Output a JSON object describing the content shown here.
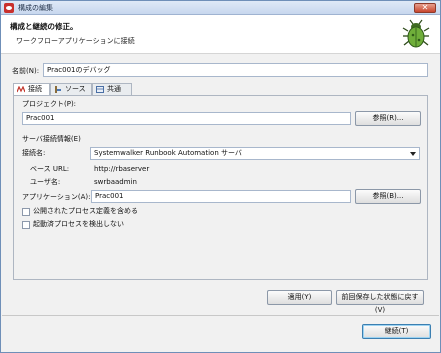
{
  "window": {
    "title": "構成の編集",
    "close_icon": "close-icon"
  },
  "header": {
    "title": "構成と継続の修正。",
    "subtitle": "ワークフローアプリケーションに接続",
    "icon": "bug-icon"
  },
  "name": {
    "label": "名前(N):",
    "value": "Prac001のデバッグ"
  },
  "tabs": [
    {
      "label": "接続",
      "icon": "connection-icon",
      "active": true
    },
    {
      "label": "ソース",
      "icon": "source-icon",
      "active": false
    },
    {
      "label": "共通(C)",
      "icon": "common-icon",
      "active": false
    }
  ],
  "project": {
    "label": "プロジェクト(P):",
    "value": "Prac001",
    "browse_label": "参照(R)..."
  },
  "server": {
    "section_label": "サーバ接続情報(E)",
    "connection_name_label": "接続名:",
    "connection_name_value": "Systemwalker Runbook Automation サーバ",
    "base_url_label": "ベース URL:",
    "base_url_value": "http://rbaserver",
    "user_label": "ユーザ名:",
    "user_value": "swrbaadmin"
  },
  "application": {
    "label": "アプリケーション(A):",
    "value": "Prac001",
    "browse_label": "参照(B)..."
  },
  "options": {
    "include_published": "公開されたプロセス定義を含める",
    "detect_running": "起動済プロセスを検出しない"
  },
  "buttons": {
    "apply": "適用(Y)",
    "revert": "前回保存した状態に戻す(V)",
    "continue": "継続(T)"
  }
}
